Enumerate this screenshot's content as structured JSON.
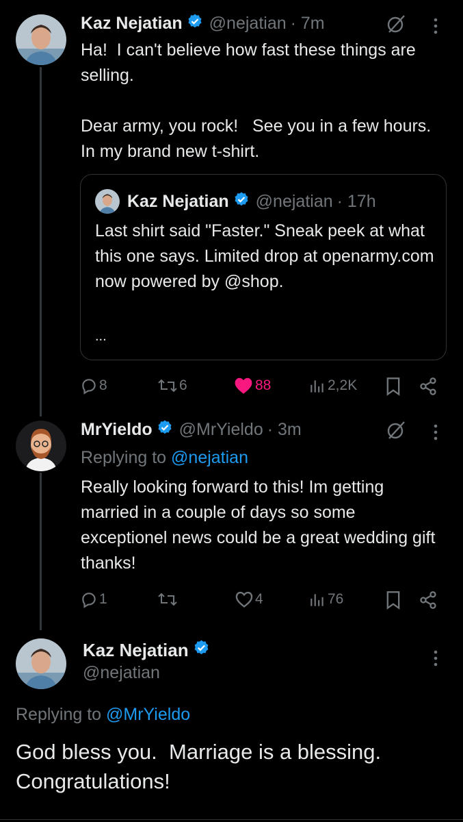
{
  "tweet1": {
    "name": "Kaz Nejatian",
    "handle": "@nejatian",
    "time": "· 7m",
    "text": "Ha!  I can't believe how fast these things are selling.\n\nDear army, you rock!   See you in a few hours. In my brand new t-shirt.",
    "quote": {
      "name": "Kaz Nejatian",
      "handle": "@nejatian",
      "time": "· 17h",
      "text": "Last shirt said \"Faster.\" Sneak peek at what this one says. Limited drop at openarmy.com now powered by @shop.",
      "ellipsis": "..."
    },
    "actions": {
      "replies": "8",
      "reposts": "6",
      "likes": "88",
      "views": "2,2K"
    }
  },
  "tweet2": {
    "name": "MrYieldo",
    "handle": "@MrYieldo",
    "time": "· 3m",
    "replying_prefix": "Replying to ",
    "replying_to": "@nejatian",
    "text": "Really looking forward to this! Im getting married in a couple of days so some exceptionel news could be a great wedding gift thanks!",
    "actions": {
      "replies": "1",
      "reposts": "",
      "likes": "4",
      "views": "76"
    }
  },
  "tweet3": {
    "name": "Kaz Nejatian",
    "handle": "@nejatian",
    "replying_prefix": "Replying to ",
    "replying_to": "@MrYieldo",
    "text": "God bless you.  Marriage is a blessing. Congratulations!"
  },
  "colors": {
    "background": "#000000",
    "text": "#e7e9ea",
    "muted": "#71767b",
    "link": "#1d9bf0",
    "like_active": "#f91880",
    "verified": "#1d9bf0"
  }
}
